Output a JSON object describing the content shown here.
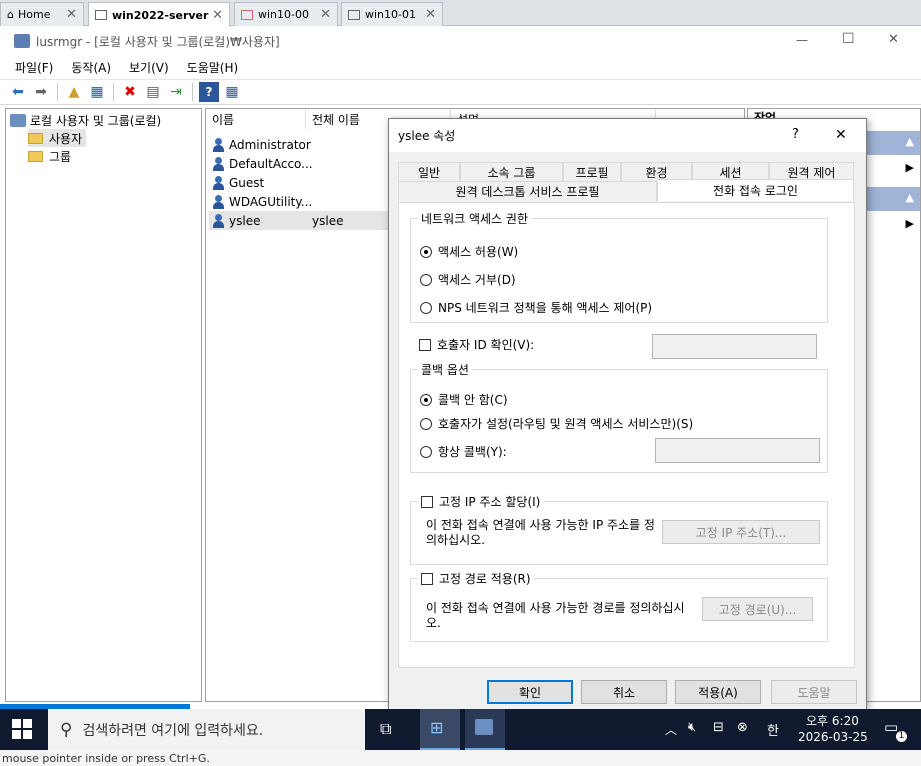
{
  "host_tabs": [
    {
      "label": "Home",
      "icon": "home-icon"
    },
    {
      "label": "win2022-server",
      "icon": "vm-icon"
    },
    {
      "label": "win10-00",
      "icon": "vm-icon"
    },
    {
      "label": "win10-01",
      "icon": "vm-icon"
    }
  ],
  "window": {
    "title": "lusrmgr - [로컬 사용자 및 그룹(로컬)₩사용자]",
    "controls": {
      "minimize": "—",
      "maximize": "☐",
      "close": "✕"
    }
  },
  "menu": [
    "파일(F)",
    "동작(A)",
    "보기(V)",
    "도움말(H)"
  ],
  "tree": {
    "root": "로컬 사용자 및 그룹(로컬)",
    "children": [
      "사용자",
      "그룹"
    ]
  },
  "list": {
    "columns": [
      "이름",
      "전체 이름",
      "설명"
    ],
    "rows": [
      {
        "name": "Administrator",
        "full_name": ""
      },
      {
        "name": "DefaultAcco...",
        "full_name": ""
      },
      {
        "name": "Guest",
        "full_name": ""
      },
      {
        "name": "WDAGUtility...",
        "full_name": ""
      },
      {
        "name": "yslee",
        "full_name": "yslee"
      }
    ]
  },
  "actions_header": "작업",
  "dialog": {
    "title": "yslee 속성",
    "help": "?",
    "close": "✕",
    "tabs_row1": [
      "일반",
      "소속 그룹",
      "프로필",
      "환경",
      "세션",
      "원격 제어"
    ],
    "tabs_row2": [
      "원격 데스크톱 서비스 프로필",
      "전화 접속 로그인"
    ],
    "network_access": {
      "label": "네트워크 액세스 권한",
      "options": [
        "액세스 허용(W)",
        "액세스 거부(D)",
        "NPS 네트워크 정책을 통해 액세스 제어(P)"
      ],
      "selected": 0
    },
    "caller_id": {
      "label": "호출자 ID 확인(V):",
      "value": ""
    },
    "callback": {
      "label": "콜백 옵션",
      "options": [
        "콜백 안 함(C)",
        "호출자가 설정(라우팅 및 원격 액세스 서비스만)(S)",
        "항상 콜백(Y):"
      ],
      "selected": 0,
      "value": ""
    },
    "static_ip": {
      "label": "고정 IP 주소 할당(I)",
      "desc": "이 전화 접속 연결에 사용 가능한 IP 주소를 정의하십시오.",
      "button": "고정 IP 주소(T)..."
    },
    "static_route": {
      "label": "고정 경로 적용(R)",
      "desc": "이 전화 접속 연결에 사용 가능한 경로를 정의하십시오.",
      "button": "고정 경로(U)..."
    },
    "buttons": {
      "ok": "확인",
      "cancel": "취소",
      "apply": "적용(A)",
      "help": "도움말"
    }
  },
  "taskbar": {
    "search_placeholder": "검색하려면 여기에 입력하세요.",
    "time": "오후 6:20",
    "date": "2026-03-25",
    "ime": "한",
    "notification_count": "1"
  },
  "footer_hint": "mouse pointer inside or press Ctrl+G.",
  "colors": {
    "accent": "#0078d7",
    "taskbar": "#101a2e",
    "progress": "#0078d7"
  }
}
